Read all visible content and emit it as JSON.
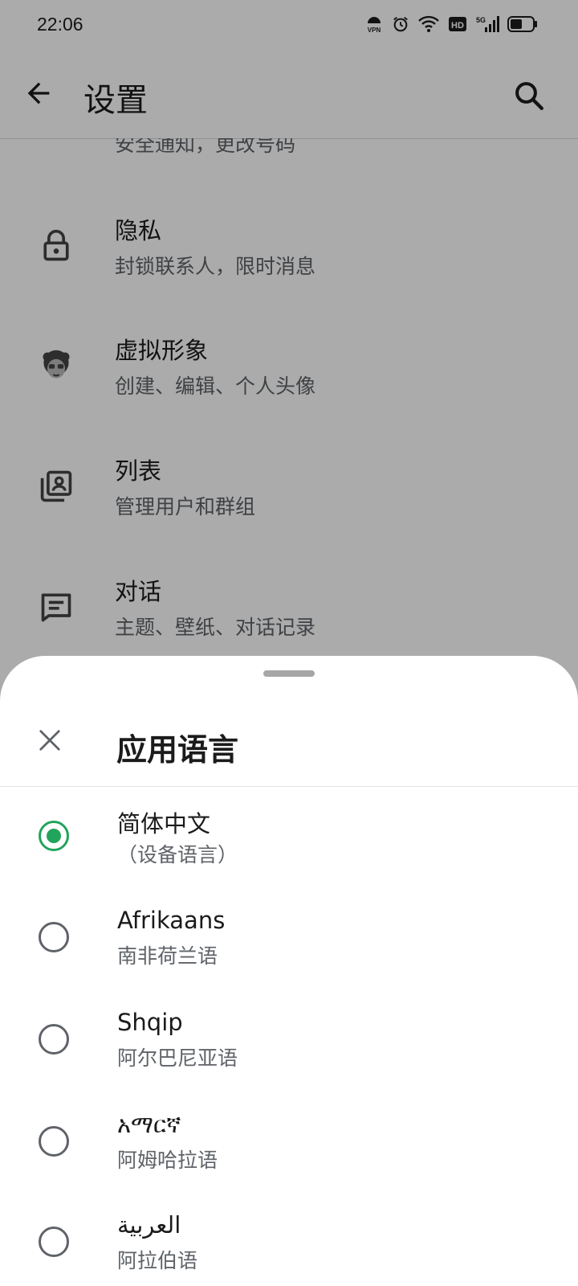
{
  "status_bar": {
    "time": "22:06",
    "icons": [
      "vpn-icon",
      "alarm-icon",
      "wifi-icon",
      "hd-icon",
      "signal-5g-icon",
      "battery-icon"
    ],
    "vpn_label": "VPN",
    "hd_label": "HD",
    "network_label": "5G"
  },
  "settings": {
    "title": "设置",
    "partial_item_subtitle": "安全通知，更改号码",
    "items": [
      {
        "icon": "lock-icon",
        "title": "隐私",
        "subtitle": "封锁联系人，限时消息"
      },
      {
        "icon": "avatar-icon",
        "title": "虚拟形象",
        "subtitle": "创建、编辑、个人头像"
      },
      {
        "icon": "lists-icon",
        "title": "列表",
        "subtitle": "管理用户和群组"
      },
      {
        "icon": "chat-icon",
        "title": "对话",
        "subtitle": "主题、壁纸、对话记录"
      }
    ]
  },
  "language_sheet": {
    "title": "应用语言",
    "options": [
      {
        "native": "简体中文",
        "translated": "（设备语言）",
        "selected": true
      },
      {
        "native": "Afrikaans",
        "translated": "南非荷兰语",
        "selected": false
      },
      {
        "native": "Shqip",
        "translated": "阿尔巴尼亚语",
        "selected": false
      },
      {
        "native": "አማርኛ",
        "translated": "阿姆哈拉语",
        "selected": false
      },
      {
        "native": "العربية",
        "translated": "阿拉伯语",
        "selected": false
      }
    ]
  },
  "colors": {
    "accent_green": "#22a45a",
    "scrim": "rgba(0,0,0,0.33)",
    "text_primary": "#1b1b1b",
    "text_secondary": "#5f6368"
  }
}
